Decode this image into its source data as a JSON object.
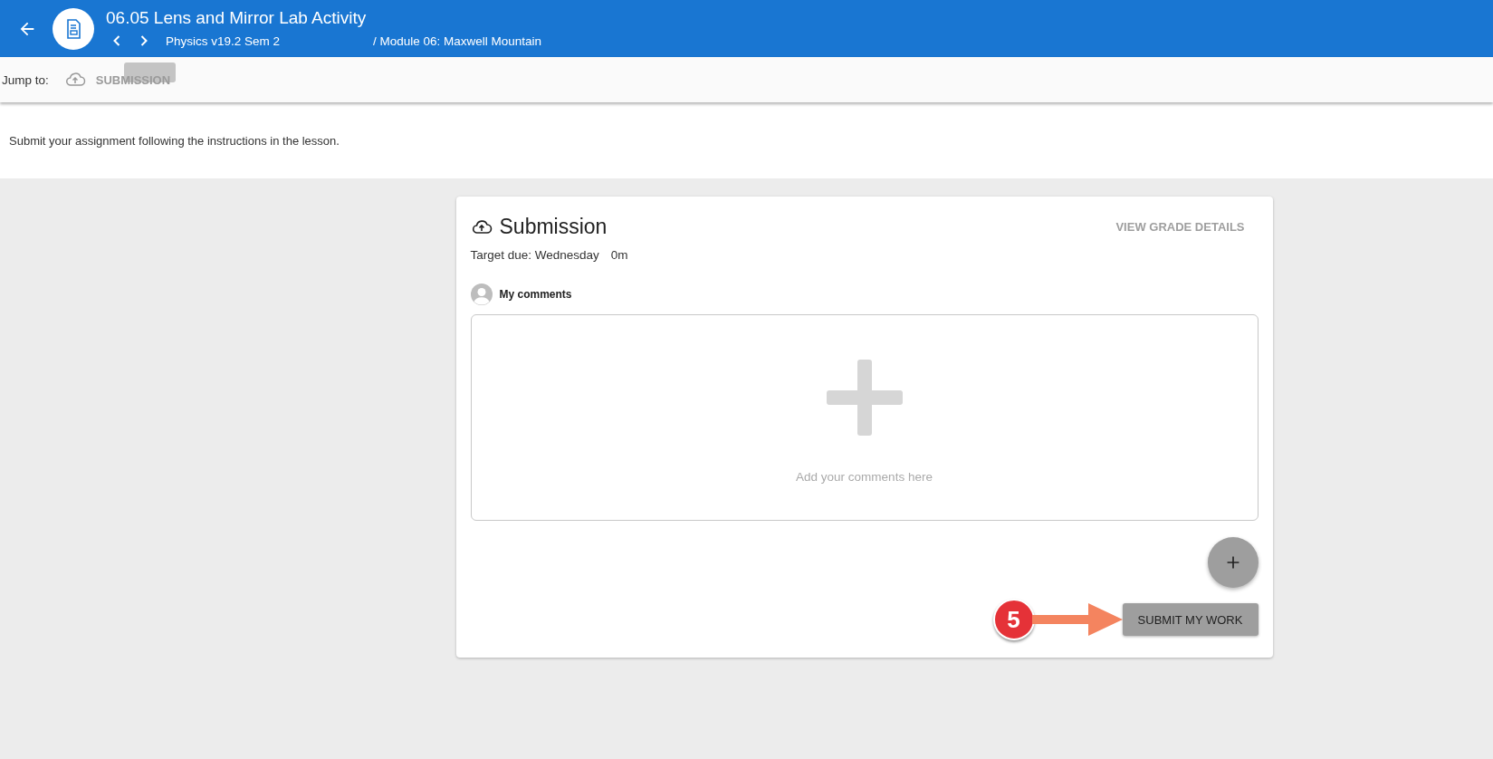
{
  "header": {
    "title": "06.05 Lens and Mirror Lab Activity",
    "course": "Physics v19.2 Sem 2",
    "module": "/ Module 06: Maxwell Mountain"
  },
  "jump_bar": {
    "label": "Jump to:",
    "link": "SUBMISSION"
  },
  "instructions": "Submit your assignment following the instructions in the lesson.",
  "card": {
    "title": "Submission",
    "grade_link": "VIEW GRADE DETAILS",
    "due": "Target due: Wednesday",
    "due_time": "0m",
    "comments_label": "My comments",
    "comments_placeholder": "Add your comments here",
    "submit_button": "SUBMIT MY WORK"
  },
  "annotation": {
    "badge": "5"
  }
}
